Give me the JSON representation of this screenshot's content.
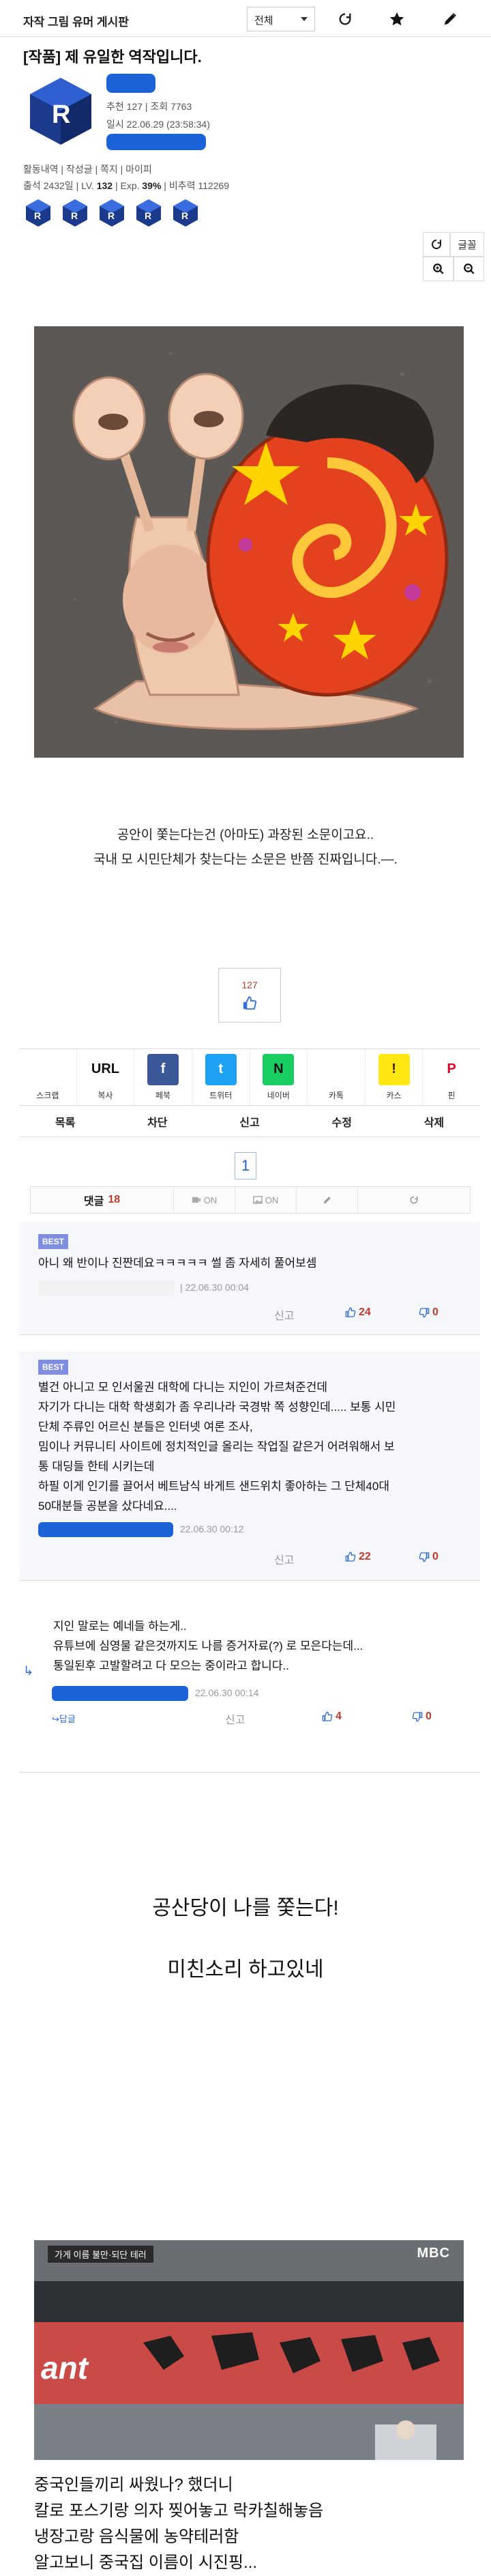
{
  "topbar": {
    "board_title": "자작 그림 유머 게시판",
    "filter_value": "전체",
    "icons": [
      "refresh-icon",
      "star-icon",
      "pencil-icon"
    ]
  },
  "post": {
    "title": "[작품] 제 유일한 역작입니다.",
    "recommend_label": "추천",
    "recommend_count": "127",
    "views_label": "조회",
    "views_count": "7763",
    "date_label": "일시",
    "date": "22.06.29 (23:58:34)",
    "links": "활동내역 | 작성글 | 쪽지 | 마이피",
    "stats": {
      "attendance": "출석 2432일",
      "level_label": "LV.",
      "level": "132",
      "exp_label": "Exp.",
      "exp": "39%",
      "contrib": "비추력 112269"
    },
    "controls": {
      "font_label": "글꼴"
    }
  },
  "body": {
    "line1": "공안이 쫓는다는건 (아마도) 과장된 소문이고요..",
    "line2": "국내 모 시민단체가 찾는다는 소문은 반쯤 진짜입니다.—."
  },
  "recommend_box": {
    "count": "127"
  },
  "share": {
    "items": [
      {
        "label": "스크랩",
        "logo": "",
        "bg": "#ffffff",
        "fg": "#1b3a8c"
      },
      {
        "label": "복사",
        "logo": "URL",
        "bg": "#ffffff",
        "fg": "#111111"
      },
      {
        "label": "페북",
        "logo": "f",
        "bg": "#3b5998",
        "fg": "#ffffff"
      },
      {
        "label": "트위터",
        "logo": "t",
        "bg": "#1da1f2",
        "fg": "#ffffff"
      },
      {
        "label": "네이버",
        "logo": "N",
        "bg": "#19ce60",
        "fg": "#111111"
      },
      {
        "label": "카톡",
        "logo": "",
        "bg": "#ffffff",
        "fg": "#333333"
      },
      {
        "label": "카스",
        "logo": "!",
        "bg": "#ffe812",
        "fg": "#3c1e1e"
      },
      {
        "label": "핀",
        "logo": "P",
        "bg": "#ffffff",
        "fg": "#e60023"
      }
    ]
  },
  "actions": [
    "목록",
    "차단",
    "신고",
    "수정",
    "삭제"
  ],
  "pagination": {
    "current": "1"
  },
  "comment_head": {
    "label": "댓글",
    "count": "18",
    "toggle1": "ON",
    "toggle2": "ON"
  },
  "comments": [
    {
      "best": "BEST",
      "lines": [
        "아니 왜 반이나 진짠데요ㅋㅋㅋㅋㅋ 썰 좀 자세히 풀어보셈"
      ],
      "date": "22.06.30 00:04",
      "report": "신고",
      "up": "24",
      "down": "0"
    },
    {
      "best": "BEST",
      "lines": [
        "별건 아니고 모 인서울권 대학에 다니는 지인이 가르쳐준건데",
        "자기가 다니는 대학 학생회가 좀 우리나라 국경밖 쪽 성향인데..... 보통 시민",
        "단체 주류인 어르신 분들은 인터넷 여론 조사,",
        "밈이나 커뮤니티 사이트에 정치적인글 올리는 작업질 같은거 어려워해서 보",
        "통 대딩들 한테 시키는데",
        "하필 이게 인기를 끌어서 베트남식 바게트 샌드위치 좋아하는 그 단체40대",
        "50대분들 공분을 샀다네요...."
      ],
      "date": "22.06.30 00:12",
      "report": "신고",
      "up": "22",
      "down": "0"
    },
    {
      "best": "",
      "lines": [
        "지인 말로는 예네들 하는게..",
        "유튜브에 심영물 같은것까지도 나름 증거자료(?) 로 모은다는데...",
        "통일된후 고발할려고 다 모으는 중이라고 합니다.."
      ],
      "date": "22.06.30 00:14",
      "reply_label": "답글",
      "report": "신고",
      "up": "4",
      "down": "0"
    }
  ],
  "body2": {
    "line1": "공산당이 나를 쫓는다!",
    "line2": "미친소리 하고있네"
  },
  "news_image": {
    "overlay_text": "가게 이름 불만·되단 테러",
    "channel": "MBC",
    "sign_text": "ant"
  },
  "captions": [
    "중국인들끼리 싸웠나? 했더니",
    "칼로 포스기랑 의자 찢어놓고 락카칠해놓음",
    "냉장고랑 음식물에 농약테러함",
    "알고보니 중국집 이름이 시진핑..."
  ]
}
